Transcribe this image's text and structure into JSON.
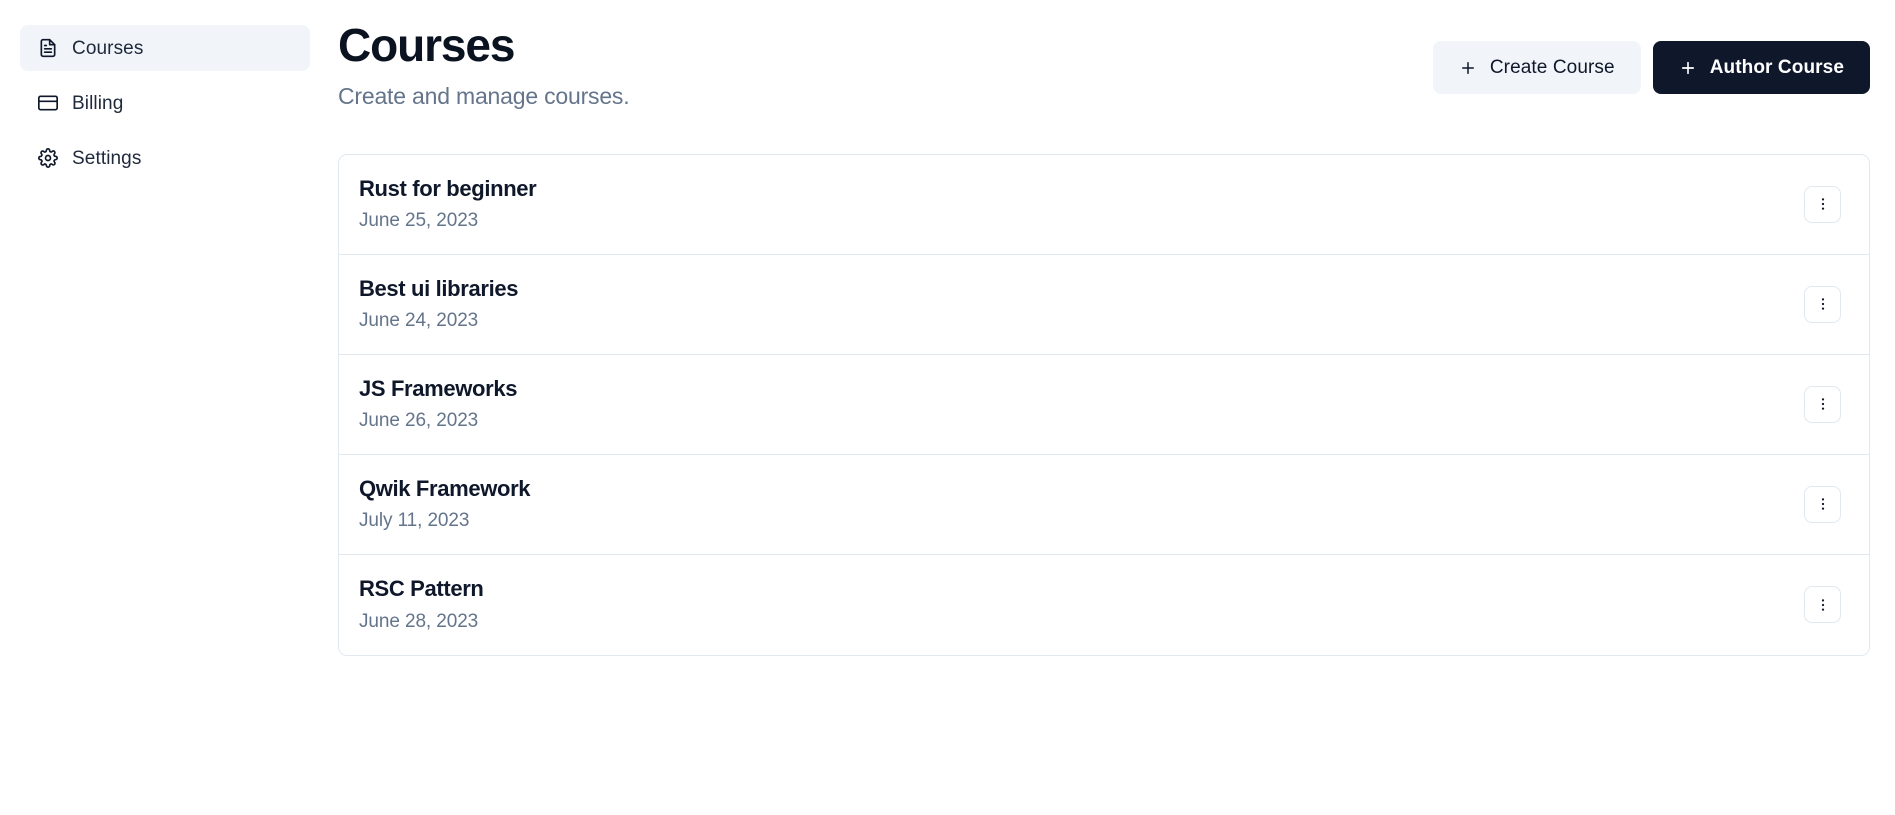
{
  "sidebar": {
    "items": [
      {
        "label": "Courses",
        "icon": "file-text-icon",
        "active": true
      },
      {
        "label": "Billing",
        "icon": "credit-card-icon",
        "active": false
      },
      {
        "label": "Settings",
        "icon": "gear-icon",
        "active": false
      }
    ]
  },
  "header": {
    "title": "Courses",
    "subtitle": "Create and manage courses.",
    "actions": {
      "create_label": "Create Course",
      "author_label": "Author Course"
    }
  },
  "courses": [
    {
      "title": "Rust for beginner",
      "date": "June 25, 2023"
    },
    {
      "title": "Best ui libraries",
      "date": "June 24, 2023"
    },
    {
      "title": "JS Frameworks",
      "date": "June 26, 2023"
    },
    {
      "title": "Qwik Framework",
      "date": "July 11, 2023"
    },
    {
      "title": "RSC Pattern",
      "date": "June 28, 2023"
    }
  ],
  "colors": {
    "accent_dark": "#0f172a",
    "muted_text": "#64748b",
    "surface_muted": "#f1f5f9",
    "border": "#e2e8f0"
  }
}
